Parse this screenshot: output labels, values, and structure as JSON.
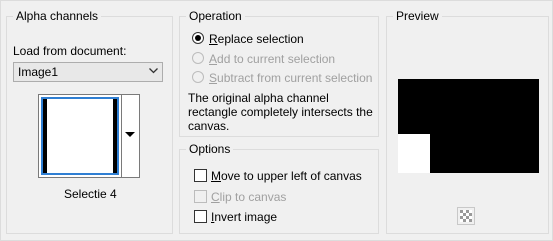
{
  "alpha_channels": {
    "title": "Alpha channels",
    "load_label": "Load from document:",
    "document_value": "Image1",
    "thumbnail_caption": "Selectie 4"
  },
  "operation": {
    "title": "Operation",
    "options": [
      {
        "label": "Replace selection",
        "accel": "R",
        "rest": "eplace selection",
        "checked": true,
        "enabled": true
      },
      {
        "label": "Add to current selection",
        "accel": "A",
        "rest": "dd to current selection",
        "checked": false,
        "enabled": false
      },
      {
        "label": "Subtract from current selection",
        "accel": "S",
        "rest": "ubtract from current selection",
        "checked": false,
        "enabled": false
      }
    ],
    "info_line1": "The original alpha channel",
    "info_line2": "rectangle completely intersects the",
    "info_line3": "canvas."
  },
  "options": {
    "title": "Options",
    "items": [
      {
        "label": "Move to upper left of canvas",
        "accel": "M",
        "rest": "ove to upper left of canvas",
        "checked": false,
        "enabled": true
      },
      {
        "label": "Clip to canvas",
        "accel": "C",
        "rest": "lip to canvas",
        "checked": false,
        "enabled": false
      },
      {
        "label": "Invert image",
        "accel": "I",
        "rest": "nvert image",
        "checked": false,
        "enabled": true
      }
    ]
  },
  "preview": {
    "title": "Preview",
    "background_color": "#000000",
    "selection_color": "#ffffff",
    "toggle_icon": "checkerboard-icon"
  }
}
